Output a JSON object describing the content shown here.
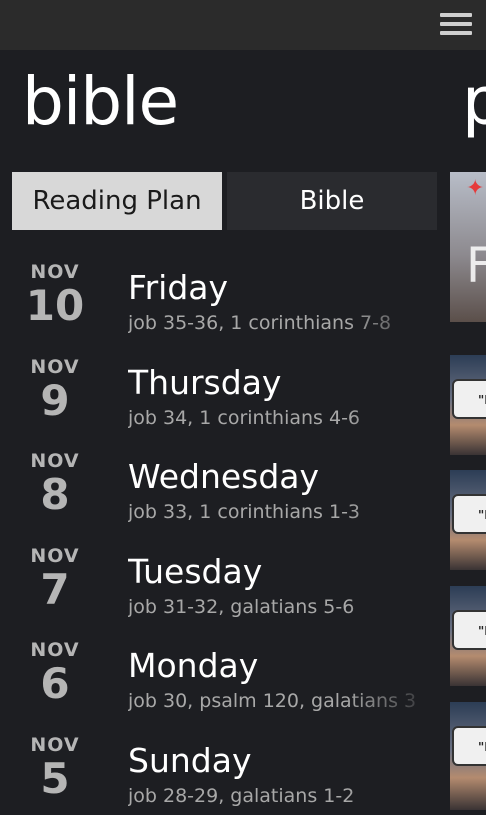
{
  "header": {
    "title": "bible",
    "next_title": "p"
  },
  "tabs": [
    {
      "label": "Reading Plan",
      "active": true
    },
    {
      "label": "Bible",
      "active": false
    }
  ],
  "plan": [
    {
      "month": "NOV",
      "day": "10",
      "weekday": "Friday",
      "readings": "job 35-36, 1 corinthians 7-8"
    },
    {
      "month": "NOV",
      "day": "9",
      "weekday": "Thursday",
      "readings": "job 34, 1 corinthians 4-6"
    },
    {
      "month": "NOV",
      "day": "8",
      "weekday": "Wednesday",
      "readings": "job 33, 1 corinthians 1-3"
    },
    {
      "month": "NOV",
      "day": "7",
      "weekday": "Tuesday",
      "readings": "job 31-32, galatians 5-6"
    },
    {
      "month": "NOV",
      "day": "6",
      "weekday": "Monday",
      "readings": "job 30, psalm 120, galatians 3"
    },
    {
      "month": "NOV",
      "day": "5",
      "weekday": "Sunday",
      "readings": "job 28-29, galatians 1-2"
    }
  ],
  "thumbs": {
    "featured_letter": "F",
    "badge_text": "\"LE"
  },
  "colors": {
    "background": "#1d1e22",
    "topbar": "#2b2b2b",
    "active_tab": "#d8d8d8",
    "inactive_tab": "#2a2b2f",
    "date_text": "#b5b5b5",
    "reading_text": "#a8a8a8"
  }
}
